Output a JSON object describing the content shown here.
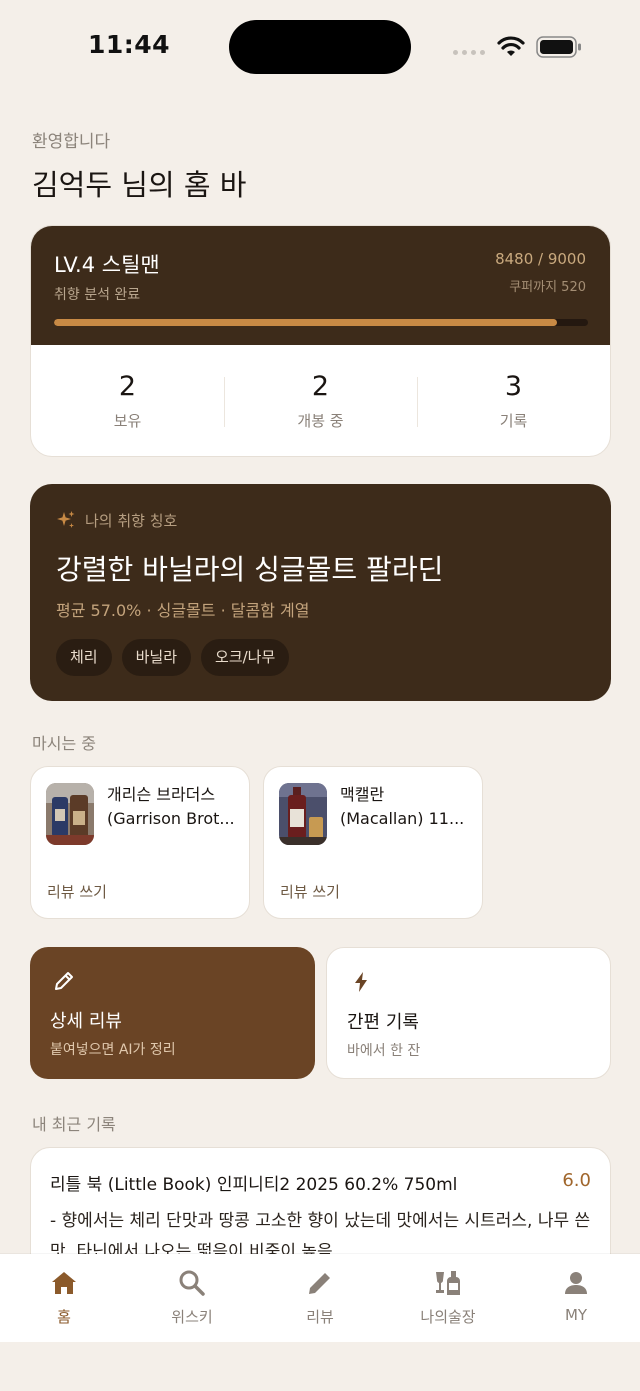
{
  "status_bar": {
    "time": "11:44"
  },
  "greeting": {
    "subtitle": "환영합니다",
    "title": "김억두 님의 홈 바"
  },
  "level": {
    "name": "LV.4 스틸맨",
    "status": "취향 분석 완료",
    "points": "8480 / 9000",
    "coupon": "쿠퍼까지 520",
    "progress_fraction": 0.942
  },
  "stats": [
    {
      "value": "2",
      "label": "보유"
    },
    {
      "value": "2",
      "label": "개봉 중"
    },
    {
      "value": "3",
      "label": "기록"
    }
  ],
  "taste": {
    "caption": "나의 취향 칭호",
    "title": "강렬한 바닐라의 싱글몰트 팔라딘",
    "meta": "평균 57.0% · 싱글몰트 · 달콤함 계열",
    "chips": [
      "체리",
      "바닐라",
      "오크/나무"
    ]
  },
  "drinking": {
    "label": "마시는 중",
    "items": [
      {
        "line1": "개리슨 브라더스",
        "line2": "(Garrison Brot...",
        "action": "리뷰 쓰기"
      },
      {
        "line1": "맥캘란",
        "line2": "(Macallan) 11...",
        "action": "리뷰 쓰기"
      }
    ]
  },
  "actions": {
    "detail": {
      "title": "상세 리뷰",
      "subtitle": "붙여넣으면 AI가 정리",
      "icon": "pencil-icon"
    },
    "quick": {
      "title": "간편 기록",
      "subtitle": "바에서 한 잔",
      "icon": "bolt-icon"
    }
  },
  "recent": {
    "label": "내 최근 기록",
    "title": "리틀 북 (Little Book) 인피니티2 2025 60.2% 750ml",
    "score": "6.0",
    "note": "- 향에서는 체리 단맛과 땅콩 고소한 향이 났는데 맛에서는 시트러스, 나무 쓴맛, 타닌에서 나오는 떫음이 비중이 높음."
  },
  "nav": [
    {
      "label": "홈",
      "icon": "home-icon",
      "active": true
    },
    {
      "label": "위스키",
      "icon": "search-icon",
      "active": false
    },
    {
      "label": "리뷰",
      "icon": "pencil-icon",
      "active": false
    },
    {
      "label": "나의술장",
      "icon": "bottles-icon",
      "active": false
    },
    {
      "label": "MY",
      "icon": "person-icon",
      "active": false
    }
  ],
  "colors": {
    "background": "#f4efe9",
    "card_dark": "#3d2b1a",
    "accent": "#c88a45",
    "action_primary": "#6a4425",
    "nav_active": "#8b5a2b",
    "nav_inactive": "#8a8179"
  }
}
